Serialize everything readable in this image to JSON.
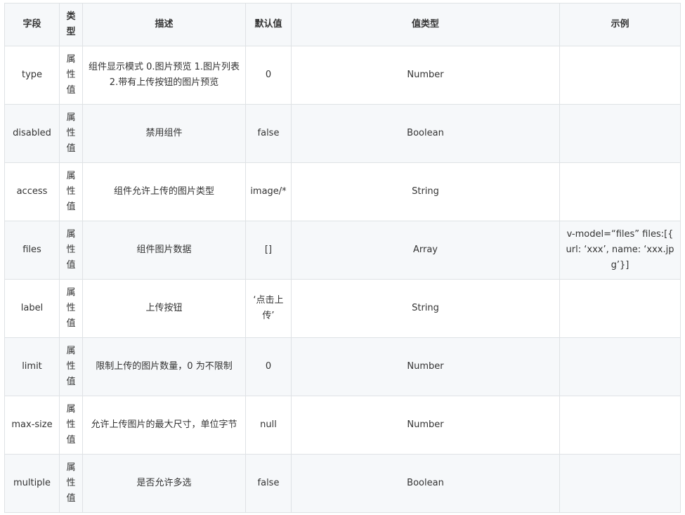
{
  "table": {
    "headers": [
      "字段",
      "类型",
      "描述",
      "默认值",
      "值类型",
      "示例"
    ],
    "rows": [
      {
        "field": "type",
        "kind": "属性值",
        "desc": "组件显示模式 0.图片预览 1.图片列表 2.带有上传按钮的图片预览",
        "default": "0",
        "value_type": "Number",
        "example": ""
      },
      {
        "field": "disabled",
        "kind": "属性值",
        "desc": "禁用组件",
        "default": "false",
        "value_type": "Boolean",
        "example": ""
      },
      {
        "field": "access",
        "kind": "属性值",
        "desc": "组件允许上传的图片类型",
        "default": "image/*",
        "value_type": "String",
        "example": ""
      },
      {
        "field": "files",
        "kind": "属性值",
        "desc": "组件图片数据",
        "default": "[]",
        "value_type": "Array",
        "example": "v-model=“files” files:[{ url: ‘xxx’, name: ‘xxx.jpg’}]"
      },
      {
        "field": "label",
        "kind": "属性值",
        "desc": "上传按钮",
        "default": "‘点击上传’",
        "value_type": "String",
        "example": ""
      },
      {
        "field": "limit",
        "kind": "属性值",
        "desc": "限制上传的图片数量，0 为不限制",
        "default": "0",
        "value_type": "Number",
        "example": ""
      },
      {
        "field": "max-size",
        "kind": "属性值",
        "desc": "允许上传图片的最大尺寸，单位字节",
        "default": "null",
        "value_type": "Number",
        "example": ""
      },
      {
        "field": "multiple",
        "kind": "属性值",
        "desc": "是否允许多选",
        "default": "false",
        "value_type": "Boolean",
        "example": ""
      }
    ]
  }
}
